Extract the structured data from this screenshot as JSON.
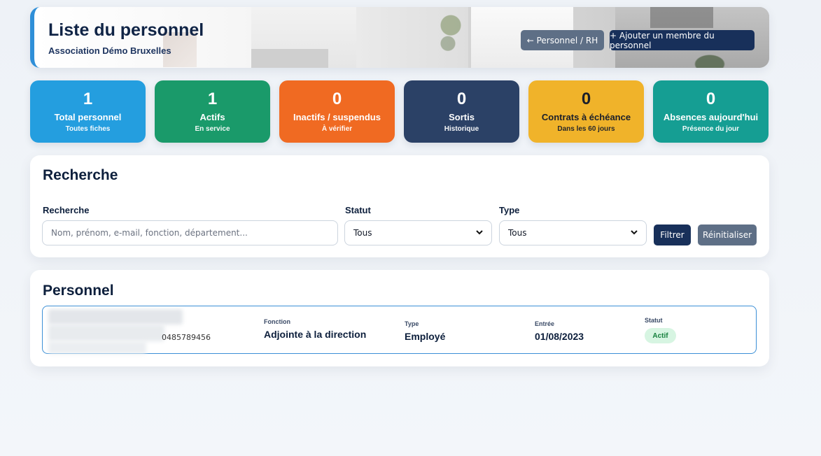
{
  "header": {
    "title": "Liste du personnel",
    "subtitle": "Association Démo Bruxelles",
    "back_button": "← Personnel / RH",
    "add_button": "+ Ajouter un membre du personnel"
  },
  "stats": [
    {
      "value": "1",
      "label": "Total personnel",
      "sub": "Toutes fiches",
      "color": "#249edf"
    },
    {
      "value": "1",
      "label": "Actifs",
      "sub": "En service",
      "color": "#1a9a6a"
    },
    {
      "value": "0",
      "label": "Inactifs / suspendus",
      "sub": "À vérifier",
      "color": "#f06a22"
    },
    {
      "value": "0",
      "label": "Sortis",
      "sub": "Historique",
      "color": "#2b4166"
    },
    {
      "value": "0",
      "label": "Contrats à échéance",
      "sub": "Dans les 60 jours",
      "color": "#f0b32a"
    },
    {
      "value": "0",
      "label": "Absences aujourd'hui",
      "sub": "Présence du jour",
      "color": "#159e93"
    }
  ],
  "search": {
    "title": "Recherche",
    "query_label": "Recherche",
    "query_placeholder": "Nom, prénom, e-mail, fonction, département...",
    "status_label": "Statut",
    "status_value": "Tous",
    "type_label": "Type",
    "type_value": "Tous",
    "filter_button": "Filtrer",
    "reset_button": "Réinitialiser"
  },
  "personnel": {
    "title": "Personnel",
    "rows": [
      {
        "phone": "0485789456",
        "fonction_label": "Fonction",
        "fonction": "Adjointe à la direction",
        "type_label": "Type",
        "type": "Employé",
        "entree_label": "Entrée",
        "entree": "01/08/2023",
        "statut_label": "Statut",
        "statut": "Actif"
      }
    ]
  }
}
